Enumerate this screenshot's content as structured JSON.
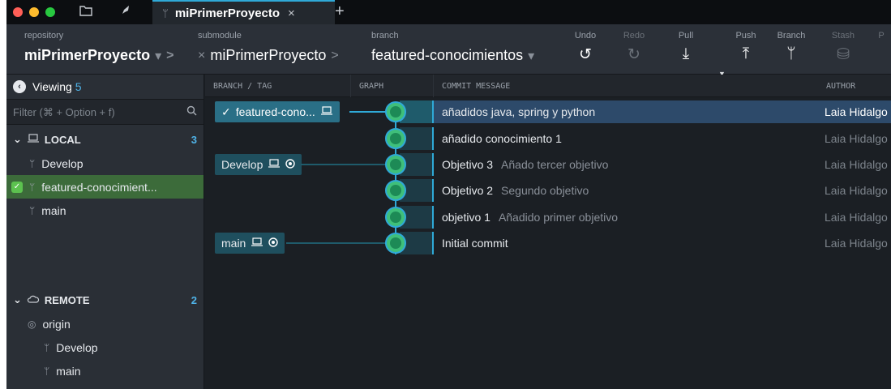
{
  "tab": {
    "title": "miPrimerProyecto",
    "close": "×",
    "plus": "+"
  },
  "toolbar": {
    "repository": {
      "caption": "repository",
      "value": "miPrimerProyecto"
    },
    "submodule": {
      "caption": "submodule",
      "value": "miPrimerProyecto"
    },
    "branch": {
      "caption": "branch",
      "value": "featured-conocimientos"
    },
    "undo": "Undo",
    "redo": "Redo",
    "pull": "Pull",
    "push": "Push",
    "branch_btn": "Branch",
    "stash": "Stash",
    "cut_off": "P"
  },
  "sidebar": {
    "viewing_label": "Viewing",
    "viewing_count": "5",
    "filter_placeholder": "Filter (⌘ + Option + f)",
    "local": {
      "label": "LOCAL",
      "count": "3",
      "items": [
        "Develop",
        "featured-conocimient...",
        "main"
      ]
    },
    "remote": {
      "label": "REMOTE",
      "count": "2",
      "origin": "origin",
      "items": [
        "Develop",
        "main"
      ]
    }
  },
  "columns": {
    "branch_tag": "BRANCH / TAG",
    "graph": "GRAPH",
    "commit_message": "COMMIT MESSAGE",
    "author": "AUTHOR"
  },
  "commits": [
    {
      "summary": "añadidos java, spring y python",
      "description": "",
      "author": "Laia Hidalgo",
      "branch": "featured-cono...",
      "check": "✓"
    },
    {
      "summary": "añadido conocimiento 1",
      "description": "",
      "author": "Laia Hidalgo",
      "branch": ""
    },
    {
      "summary": "Objetivo 3",
      "description": "Añado tercer objetivo",
      "author": "Laia Hidalgo",
      "branch": "Develop"
    },
    {
      "summary": "Objetivo 2",
      "description": "Segundo objetivo",
      "author": "Laia Hidalgo",
      "branch": ""
    },
    {
      "summary": "objetivo 1",
      "description": "Añadido primer objetivo",
      "author": "Laia Hidalgo",
      "branch": ""
    },
    {
      "summary": "Initial commit",
      "description": "",
      "author": "Laia Hidalgo",
      "branch": "main"
    }
  ],
  "colors": {
    "accent": "#2fa9d7",
    "selected_row": "#2d4a6a",
    "active_branch": "#3c6b3a"
  }
}
